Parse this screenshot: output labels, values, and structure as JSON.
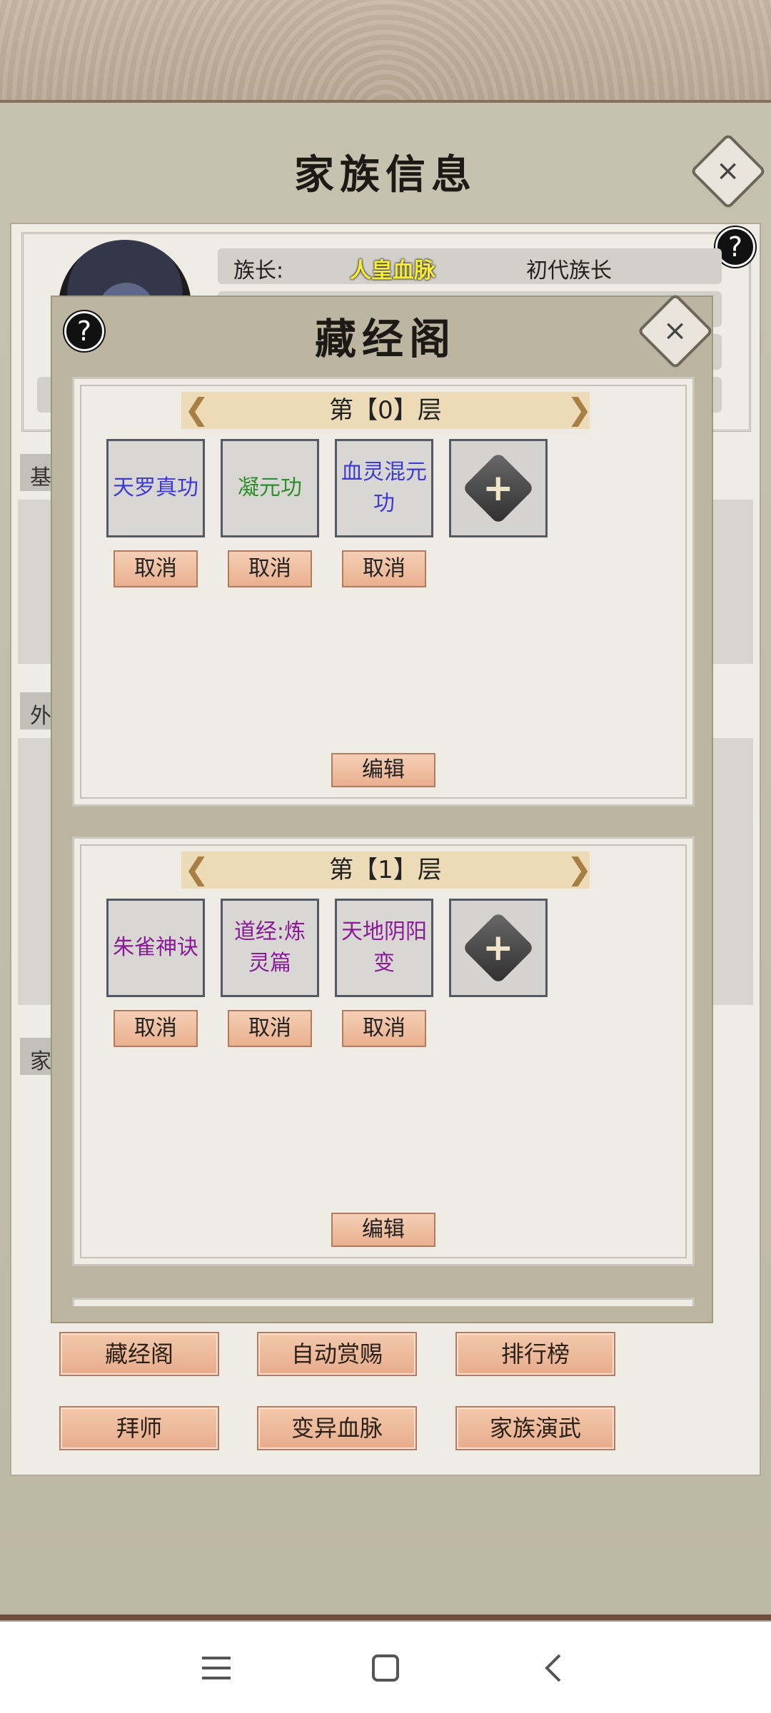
{
  "family_panel": {
    "title": "家族信息",
    "leader_label": "族长:",
    "leader_name": "人皇血脉",
    "leader_title": "初代族长",
    "side_tabs": [
      "基",
      "外",
      "家"
    ]
  },
  "buttons_row1": [
    "藏经阁",
    "自动赏赐",
    "排行榜"
  ],
  "buttons_row2": [
    "拜师",
    "变异血脉",
    "家族演武"
  ],
  "modal": {
    "title": "藏经阁",
    "floors": [
      {
        "label": "第【0】层",
        "slots": [
          {
            "name": "天罗真功",
            "color": "#3e3bd4"
          },
          {
            "name": "凝元功",
            "color": "#2d8f2c"
          },
          {
            "name": "血灵混元功",
            "color": "#3e3bd4"
          }
        ],
        "cancel_label": "取消",
        "edit_label": "编辑"
      },
      {
        "label": "第【1】层",
        "slots": [
          {
            "name": "朱雀神诀",
            "color": "#8b1a98"
          },
          {
            "name": "道经:炼灵篇",
            "color": "#8b1a98"
          },
          {
            "name": "天地阴阳变",
            "color": "#8b1a98"
          }
        ],
        "cancel_label": "取消",
        "edit_label": "编辑"
      }
    ]
  },
  "icons": {
    "help": "?",
    "close": "×",
    "plus": "+"
  }
}
